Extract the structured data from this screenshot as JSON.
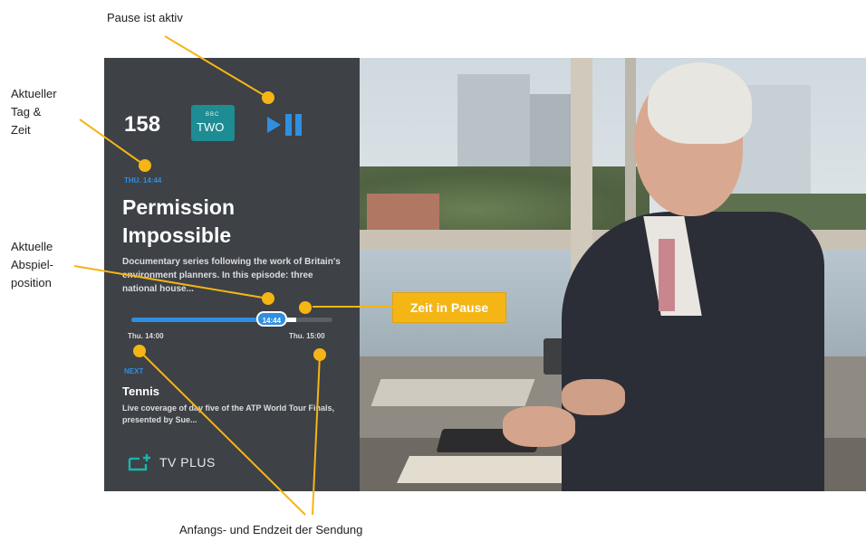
{
  "annotations": {
    "pause_active": "Pause ist aktiv",
    "current_day_time": [
      "Aktueller",
      "Tag &",
      "Zeit"
    ],
    "current_position": [
      "Aktuelle",
      "Abspiel-",
      "position"
    ],
    "paused_time": "Zeit in Pause",
    "start_end_time": "Anfangs- und Endzeit der Sendung"
  },
  "osd": {
    "channel_number": "158",
    "channel_logo_small": "BBC",
    "channel_logo": "TWO",
    "current_time": "THU. 14:44",
    "title": "Permission Impossible",
    "description": "Documentary series following the work of Britain's environment planners. In this episode: three national house...",
    "progress": {
      "current_label": "14:44",
      "played_fraction": 0.72,
      "paused_fraction": 0.82
    },
    "start_time": "Thu. 14:00",
    "end_time": "Thu. 15:00",
    "next_label": "NEXT",
    "next_title": "Tennis",
    "next_description": "Live coverage of day five of the ATP World Tour Finals, presented by Sue...",
    "brand": "TV PLUS"
  },
  "colors": {
    "accent": "#2f8fe0",
    "annotation": "#f4b515",
    "panel": "#3a3e44"
  },
  "icons": {
    "playpause": "play-pause-icon",
    "brand": "tv-plus-logo-icon"
  }
}
